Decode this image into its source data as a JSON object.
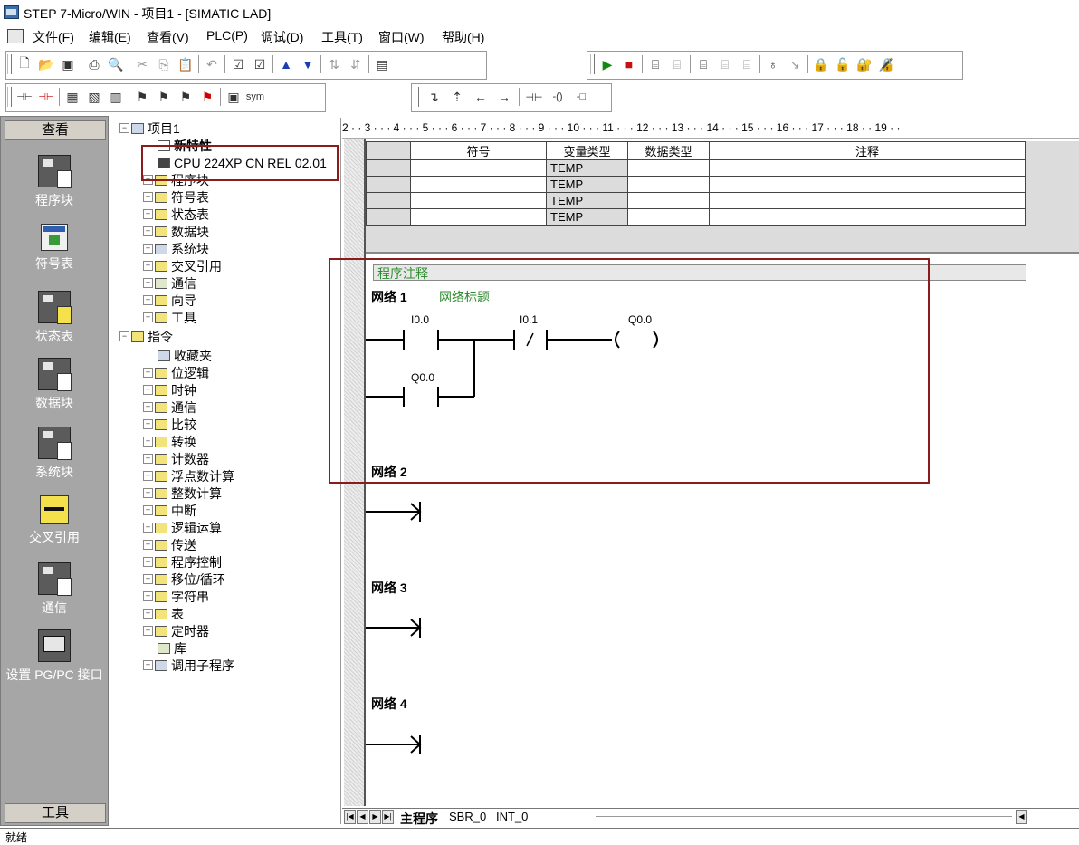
{
  "window": {
    "title": "STEP 7-Micro/WIN - 项目1 - [SIMATIC LAD]"
  },
  "menu": [
    "文件(F)",
    "编辑(E)",
    "查看(V)",
    "PLC(P)",
    "调试(D)",
    "工具(T)",
    "窗口(W)",
    "帮助(H)"
  ],
  "toolbar2": {
    "sym_label": "sym"
  },
  "nav": {
    "header": "查看",
    "footer": "工具",
    "items": [
      "程序块",
      "符号表",
      "状态表",
      "数据块",
      "系统块",
      "交叉引用",
      "通信",
      "设置 PG/PC 接口"
    ]
  },
  "tree": {
    "project": "项目1",
    "new_features": "新特性",
    "cpu": "CPU 224XP CN REL 02.01",
    "project_children": [
      "程序块",
      "符号表",
      "状态表",
      "数据块",
      "系统块",
      "交叉引用",
      "通信",
      "向导",
      "工具"
    ],
    "instructions": "指令",
    "instruction_children": [
      "收藏夹",
      "位逻辑",
      "时钟",
      "通信",
      "比较",
      "转换",
      "计数器",
      "浮点数计算",
      "整数计算",
      "中断",
      "逻辑运算",
      "传送",
      "程序控制",
      "移位/循环",
      "字符串",
      "表",
      "定时器",
      "库",
      "调用子程序"
    ]
  },
  "ruler": "2 · · 3 · · · 4 · · · 5 · · · 6 · · · 7 · · · 8 · · · 9 · · · 10 · · · 11 · · · 12 · · · 13 · · · 14 · · · 15 · · · 16 · · · 17 · · · 18 ·   · 19 · ·",
  "var_table": {
    "headers": [
      "符号",
      "变量类型",
      "数据类型",
      "注释"
    ],
    "rows": [
      [
        "",
        "TEMP",
        "",
        ""
      ],
      [
        "",
        "TEMP",
        "",
        ""
      ],
      [
        "",
        "TEMP",
        "",
        ""
      ],
      [
        "",
        "TEMP",
        "",
        ""
      ]
    ]
  },
  "program": {
    "comment": "程序注释",
    "networks": [
      {
        "label": "网络 1",
        "title": "网络标题",
        "contacts": [
          "I0.0",
          "I0.1",
          "Q0.0"
        ],
        "coil": "Q0.0"
      },
      {
        "label": "网络 2"
      },
      {
        "label": "网络 3"
      },
      {
        "label": "网络 4"
      }
    ]
  },
  "tabs": [
    "主程序",
    "SBR_0",
    "INT_0"
  ],
  "status": {
    "text": "就绪"
  }
}
